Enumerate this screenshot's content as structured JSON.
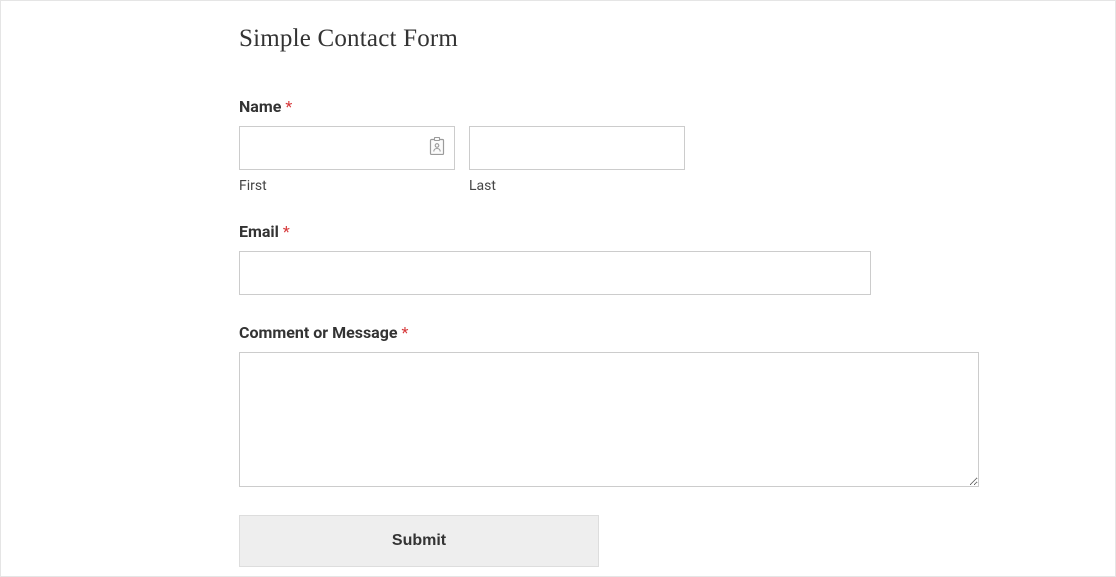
{
  "form": {
    "title": "Simple Contact Form",
    "name": {
      "label": "Name",
      "required": "*",
      "first_sublabel": "First",
      "last_sublabel": "Last",
      "first_value": "",
      "last_value": ""
    },
    "email": {
      "label": "Email",
      "required": "*",
      "value": ""
    },
    "message": {
      "label": "Comment or Message",
      "required": "*",
      "value": ""
    },
    "submit_label": "Submit"
  }
}
